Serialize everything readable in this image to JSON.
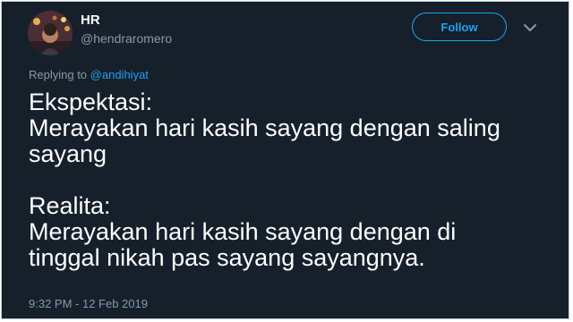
{
  "user": {
    "name": "HR",
    "handle": "@hendraromero"
  },
  "header": {
    "follow_label": "Follow",
    "menu_icon": "chevron-down-icon"
  },
  "reply": {
    "prefix": "Replying to",
    "mention": "@andihiyat"
  },
  "tweet": {
    "lines": [
      "Ekspektasi:",
      "Merayakan hari kasih sayang dengan saling",
      "sayang",
      "Realita:",
      "Merayakan hari kasih sayang dengan di",
      "tinggal nikah pas sayang sayangnya."
    ],
    "timestamp": "9:32 PM - 12 Feb 2019"
  },
  "colors": {
    "background": "#15202b",
    "accent": "#1da1f2",
    "secondary_text": "#8899a6"
  }
}
